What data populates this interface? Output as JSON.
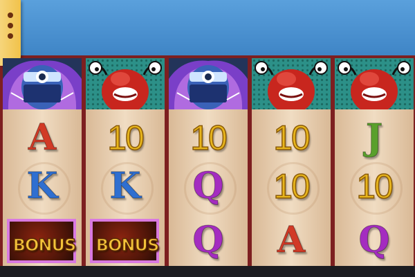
{
  "menu": {
    "icon": "menu-dots-icon"
  },
  "reels": [
    {
      "top": "cyclops-character",
      "rows": [
        {
          "t": "A",
          "kind": "ace"
        },
        {
          "t": "K",
          "kind": "king"
        },
        {
          "t": "BONUS",
          "kind": "bonus"
        }
      ]
    },
    {
      "top": "red-mascot-character",
      "rows": [
        {
          "t": "10",
          "kind": "ten"
        },
        {
          "t": "K",
          "kind": "king"
        },
        {
          "t": "BONUS",
          "kind": "bonus"
        }
      ]
    },
    {
      "top": "cyclops-character",
      "rows": [
        {
          "t": "10",
          "kind": "ten"
        },
        {
          "t": "Q",
          "kind": "queen"
        },
        {
          "t": "Q",
          "kind": "queen"
        }
      ]
    },
    {
      "top": "red-mascot-character",
      "rows": [
        {
          "t": "10",
          "kind": "ten"
        },
        {
          "t": "10",
          "kind": "ten"
        },
        {
          "t": "A",
          "kind": "ace"
        }
      ]
    },
    {
      "top": "red-mascot-character",
      "rows": [
        {
          "t": "J",
          "kind": "jack"
        },
        {
          "t": "10",
          "kind": "ten"
        },
        {
          "t": "Q",
          "kind": "queen"
        }
      ]
    }
  ],
  "colors": {
    "frame": "#7d1f20",
    "sky": "#4a90d0",
    "menu": "#f1c24a"
  }
}
